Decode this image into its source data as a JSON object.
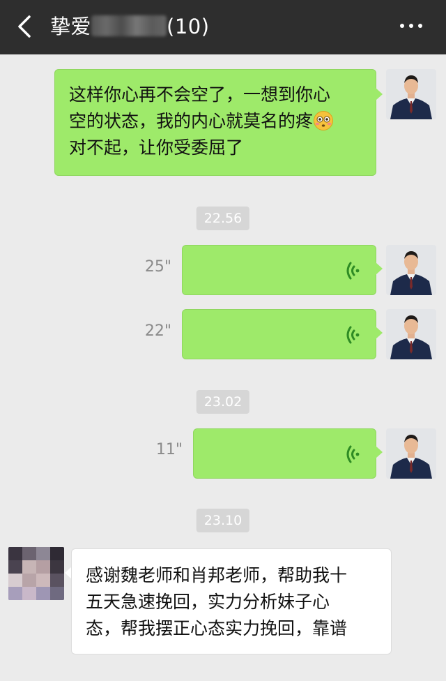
{
  "header": {
    "title_prefix": "挚爱",
    "title_suffix": "(10)",
    "back_icon": "chevron-left-icon",
    "more_icon": "more-dots-icon",
    "bg_color": "#2e2e2e"
  },
  "messages": {
    "m1": {
      "line1": "这样你心再不会空了，一想到你心",
      "line2": "空的状态，我的内心就莫名的疼",
      "line3": "对不起，让你受委屈了",
      "emoji": "flushed-face-emoji"
    },
    "time1": "22.56",
    "voice1": {
      "duration": "25\""
    },
    "voice2": {
      "duration": "22\""
    },
    "time2": "23.02",
    "voice3": {
      "duration": "11\""
    },
    "time3": "23.10",
    "m2": {
      "line1": "感谢魏老师和肖邦老师，帮助我十",
      "line2": "五天急速挽回，实力分析妹子心",
      "line3": "态，帮我摆正心态实力挽回，靠谱"
    }
  },
  "colors": {
    "sent_bubble": "#9eea6a",
    "received_bubble": "#ffffff",
    "background": "#ebebeb",
    "timestamp_bg": "#d6d6d6"
  }
}
